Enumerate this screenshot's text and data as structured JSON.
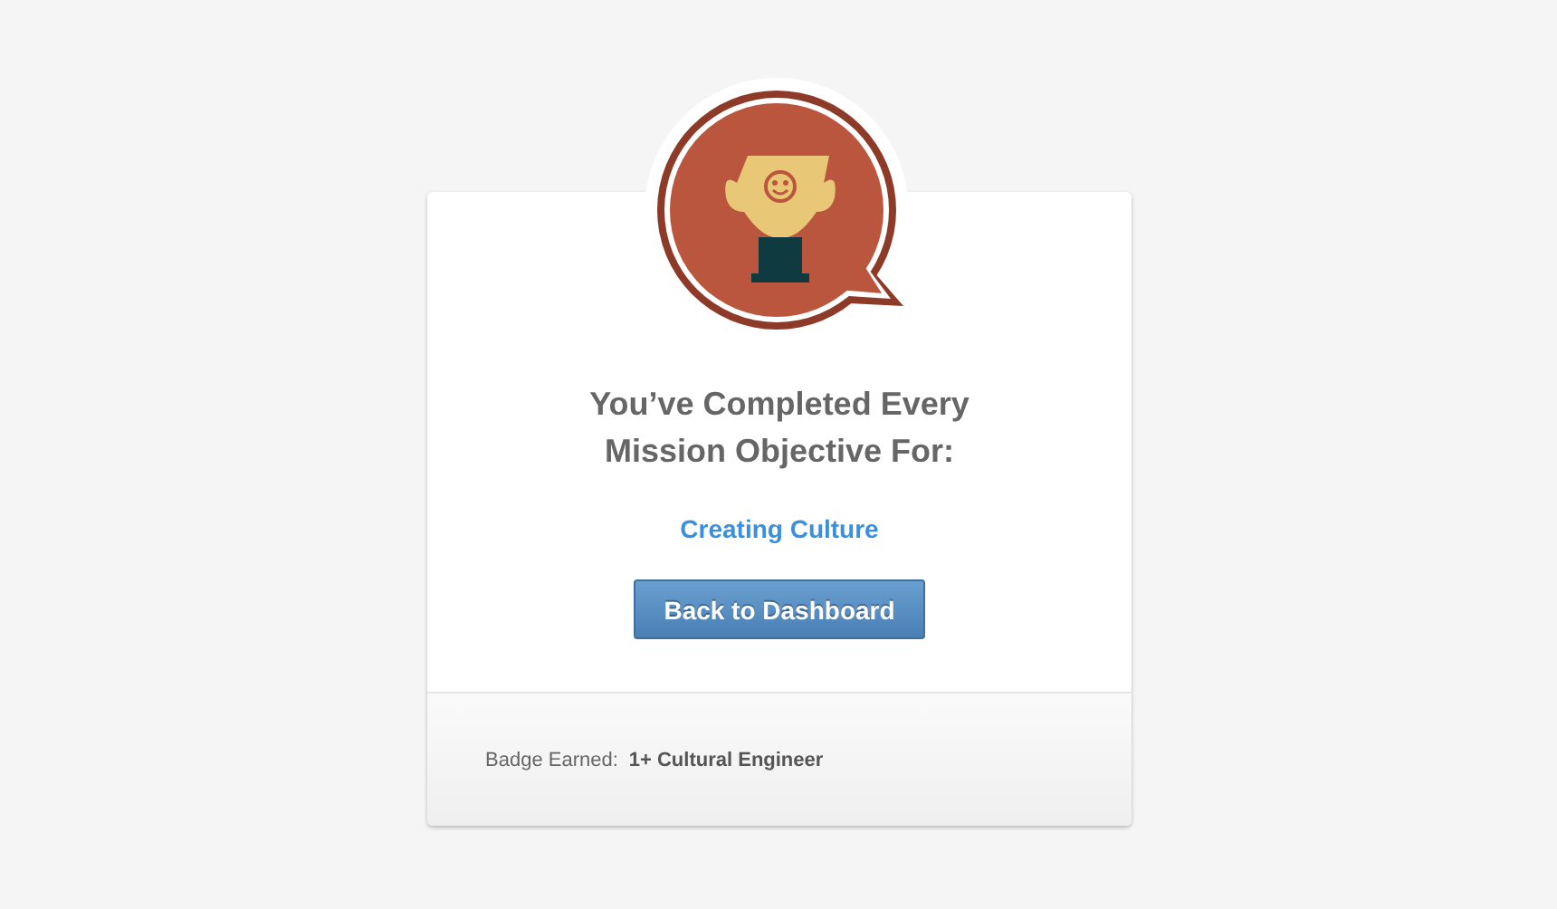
{
  "heading": "You’ve Completed Every Mission Objective For:",
  "mission": "Creating Culture",
  "button": "Back to Dashboard",
  "footer": {
    "label": "Badge Earned:",
    "value": "1+ Cultural Engineer"
  }
}
